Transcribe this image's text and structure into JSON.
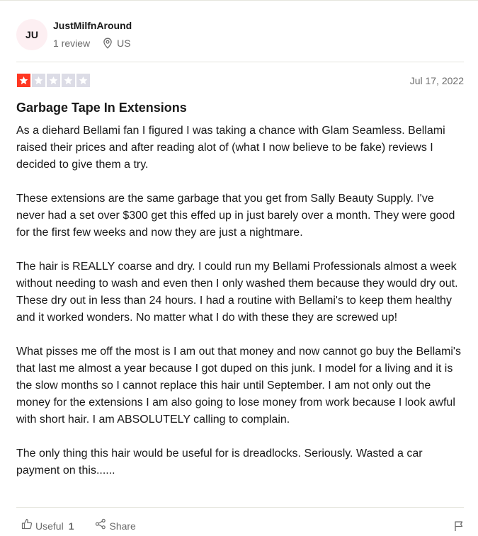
{
  "reviewer": {
    "initials": "JU",
    "name": "JustMilfnAround",
    "review_count": "1 review",
    "country": "US"
  },
  "review": {
    "rating": 1,
    "max_rating": 5,
    "star_color": "#ff3722",
    "date": "Jul 17, 2022",
    "title": "Garbage Tape In Extensions",
    "paragraphs": [
      "As a diehard Bellami fan I figured I was taking a chance with Glam Seamless. Bellami raised their prices and after reading alot of (what I now believe to be fake) reviews I decided to give them a try.",
      "These extensions are the same garbage that you get from Sally Beauty Supply. I've never had a set over $300 get this effed up in just barely over a month. They were good for the first few weeks and now they are just a nightmare.",
      "The hair is REALLY coarse and dry. I could run my Bellami Professionals almost a week without needing to wash and even then I only washed them because they would dry out. These dry out in less than 24 hours. I had a routine with Bellami's to keep them healthy and it worked wonders. No matter what I do with these they are screwed up!",
      "What pisses me off the most is I am out that money and now cannot go buy the Bellami's that last me almost a year because I got duped on this junk. I model for a living and it is the slow months so I cannot replace this hair until September. I am not only out the money for the extensions I am also going to lose money from work because I look awful with short hair. I am ABSOLUTELY calling to complain.",
      "The only thing this hair would be useful for is dreadlocks. Seriously. Wasted a car payment on this......"
    ]
  },
  "actions": {
    "useful_label": "Useful",
    "useful_count": "1",
    "share_label": "Share"
  },
  "icons": {
    "location": "map-pin-icon",
    "useful": "thumbs-up-icon",
    "share": "share-icon",
    "flag": "flag-icon",
    "star": "star-icon"
  }
}
